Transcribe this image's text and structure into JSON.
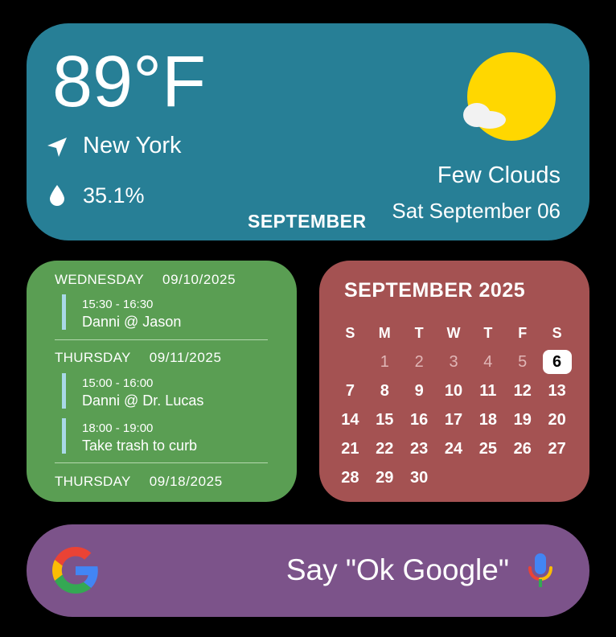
{
  "weather": {
    "temperature": "89°F",
    "location": "New York",
    "humidity": "35.1%",
    "condition": "Few Clouds",
    "date": "Sat September 06",
    "month_label": "SEPTEMBER",
    "icons": {
      "location": "navigation-arrow-icon",
      "humidity": "water-drop-icon",
      "weather": "sun-with-cloud-icon"
    },
    "colors": {
      "background": "#277F96",
      "sun": "#FFD700"
    }
  },
  "agenda": {
    "days": [
      {
        "name": "WEDNESDAY",
        "date": "09/10/2025",
        "events": [
          {
            "time": "15:30 - 16:30",
            "title": "Danni @ Jason"
          }
        ]
      },
      {
        "name": "THURSDAY",
        "date": "09/11/2025",
        "events": [
          {
            "time": "15:00 - 16:00",
            "title": "Danni @ Dr. Lucas"
          },
          {
            "time": "18:00 - 19:00",
            "title": "Take trash to curb"
          }
        ]
      },
      {
        "name": "THURSDAY",
        "date": "09/18/2025",
        "events": []
      }
    ],
    "colors": {
      "background": "#5A9E53",
      "event_bar": "#A9D9E8"
    }
  },
  "calendar": {
    "title": "SEPTEMBER 2025",
    "weekdays": [
      "S",
      "M",
      "T",
      "W",
      "T",
      "F",
      "S"
    ],
    "weeks": [
      [
        "",
        "1",
        "2",
        "3",
        "4",
        "5",
        "6"
      ],
      [
        "7",
        "8",
        "9",
        "10",
        "11",
        "12",
        "13"
      ],
      [
        "14",
        "15",
        "16",
        "17",
        "18",
        "19",
        "20"
      ],
      [
        "21",
        "22",
        "23",
        "24",
        "25",
        "26",
        "27"
      ],
      [
        "28",
        "29",
        "30",
        "",
        "",
        "",
        ""
      ]
    ],
    "past_days": [
      "1",
      "2",
      "3",
      "4",
      "5"
    ],
    "today": "6",
    "colors": {
      "background": "#A45252"
    }
  },
  "search": {
    "prompt": "Say \"Ok Google\"",
    "icons": {
      "logo": "google-g-icon",
      "mic": "microphone-icon"
    },
    "colors": {
      "background": "#7C538A"
    }
  }
}
